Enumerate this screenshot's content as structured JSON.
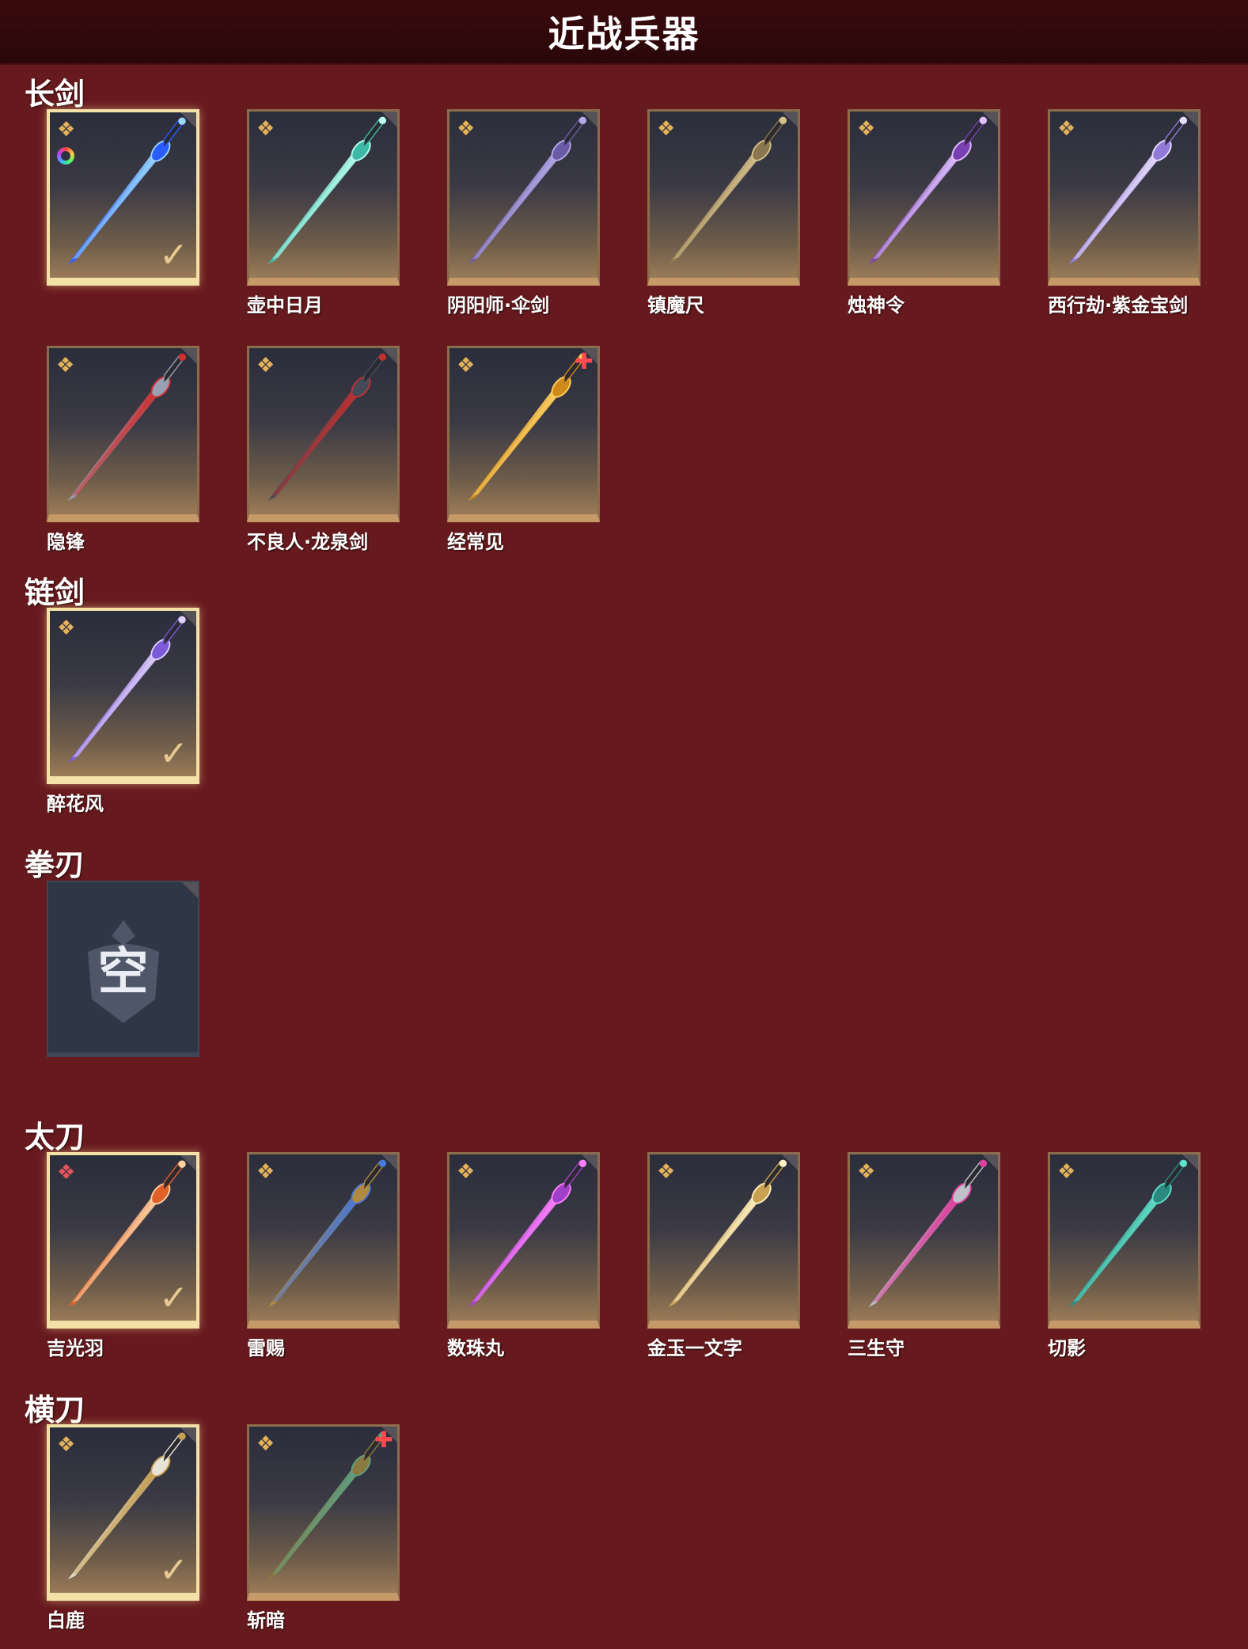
{
  "header": {
    "title": "近战兵器"
  },
  "sections": [
    {
      "title": "长剑",
      "items": [
        {
          "name": "",
          "selected": true,
          "star": "gold",
          "dye": true,
          "new": false,
          "colors": [
            "#2a5cff",
            "#9ad8ff"
          ]
        },
        {
          "name": "壶中日月",
          "selected": false,
          "star": "gold",
          "dye": false,
          "new": false,
          "colors": [
            "#3fb8a8",
            "#b8fff0"
          ]
        },
        {
          "name": "阴阳师·伞剑",
          "selected": false,
          "star": "gold",
          "dye": false,
          "new": false,
          "colors": [
            "#6b5ca8",
            "#b4a8e6"
          ]
        },
        {
          "name": "镇魔尺",
          "selected": false,
          "star": "gold",
          "dye": false,
          "new": false,
          "colors": [
            "#8a7650",
            "#d6c08a"
          ]
        },
        {
          "name": "烛神令",
          "selected": false,
          "star": "gold",
          "dye": false,
          "new": false,
          "colors": [
            "#7a3fb0",
            "#e0c0ff"
          ]
        },
        {
          "name": "西行劫·紫金宝剑",
          "selected": false,
          "star": "gold",
          "dye": false,
          "new": false,
          "colors": [
            "#8f7ad8",
            "#e8dcff"
          ]
        },
        {
          "name": "隐锋",
          "selected": false,
          "star": "gold",
          "dye": false,
          "new": false,
          "colors": [
            "#9aa0b4",
            "#d03030"
          ]
        },
        {
          "name": "不良人·龙泉剑",
          "selected": false,
          "star": "gold",
          "dye": false,
          "new": false,
          "colors": [
            "#444a58",
            "#c03030"
          ]
        },
        {
          "name": "经常见",
          "selected": false,
          "star": "gold",
          "dye": false,
          "new": true,
          "colors": [
            "#d08a1a",
            "#ffd060"
          ]
        }
      ]
    },
    {
      "title": "链剑",
      "items": [
        {
          "name": "醉花风",
          "selected": true,
          "star": "gold",
          "dye": false,
          "new": false,
          "colors": [
            "#7a5ad8",
            "#e0d0ff"
          ]
        }
      ]
    },
    {
      "title": "拳刃",
      "items": [
        {
          "name": "",
          "empty": true,
          "empty_label": "空"
        }
      ]
    },
    {
      "title": "太刀",
      "items": [
        {
          "name": "吉光羽",
          "selected": true,
          "star": "red",
          "dye": false,
          "new": false,
          "colors": [
            "#e0602a",
            "#ffd0a0"
          ]
        },
        {
          "name": "雷赐",
          "selected": false,
          "star": "gold",
          "dye": false,
          "new": false,
          "colors": [
            "#b08a40",
            "#4a7ad8"
          ]
        },
        {
          "name": "数珠丸",
          "selected": false,
          "star": "gold",
          "dye": false,
          "new": false,
          "colors": [
            "#a040c8",
            "#ff80ff"
          ]
        },
        {
          "name": "金玉一文字",
          "selected": false,
          "star": "gold",
          "dye": false,
          "new": false,
          "colors": [
            "#c8a050",
            "#fff0c0"
          ]
        },
        {
          "name": "三生守",
          "selected": false,
          "star": "gold",
          "dye": false,
          "new": false,
          "colors": [
            "#c0c0c8",
            "#e040a0"
          ]
        },
        {
          "name": "切影",
          "selected": false,
          "star": "gold",
          "dye": false,
          "new": false,
          "colors": [
            "#2a8a80",
            "#60e0c8"
          ]
        }
      ]
    },
    {
      "title": "横刀",
      "items": [
        {
          "name": "白鹿",
          "selected": true,
          "star": "gold",
          "dye": false,
          "new": false,
          "colors": [
            "#e8e4d8",
            "#c8a050"
          ]
        },
        {
          "name": "斩暗",
          "selected": false,
          "star": "gold",
          "dye": false,
          "new": true,
          "colors": [
            "#8a7a40",
            "#60a080"
          ]
        }
      ]
    }
  ],
  "icons": {
    "star": "❖",
    "check": "✓",
    "new": "✚"
  }
}
